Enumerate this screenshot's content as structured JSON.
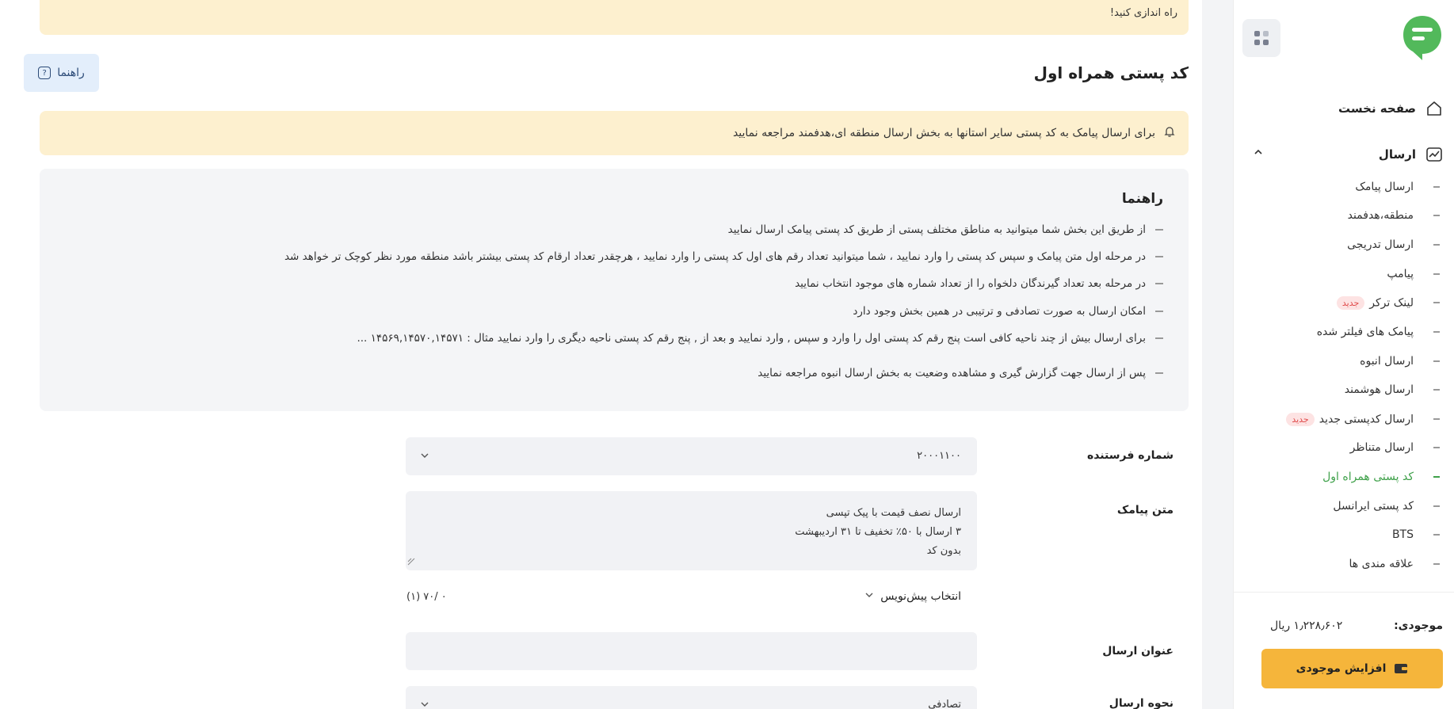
{
  "brand": {
    "accent": "#3fa14a",
    "warning_bg": "#fdf0cf",
    "topup": "#f5b53b"
  },
  "sidebar": {
    "home": "صفحه نخست",
    "send_group": "ارسال",
    "items": [
      {
        "label": "ارسال پیامک"
      },
      {
        "label": "منطقه،هدفمند"
      },
      {
        "label": "ارسال تدریجی"
      },
      {
        "label": "پیامپ"
      },
      {
        "label": "لینک ترکر",
        "badge": "جدید"
      },
      {
        "label": "پیامک های فیلتر شده"
      },
      {
        "label": "ارسال انبوه"
      },
      {
        "label": "ارسال هوشمند"
      },
      {
        "label": "ارسال کدپستی جدید",
        "badge": "جدید"
      },
      {
        "label": "ارسال متناظر"
      },
      {
        "label": "کد پستی همراه اول",
        "active": true
      },
      {
        "label": "کد پستی ایرانسل"
      },
      {
        "label": "BTS"
      },
      {
        "label": "علاقه مندی ها"
      }
    ],
    "balance_label": "موجودی:",
    "balance_value": "۱٫۲۲۸٫۶۰۲ ریال",
    "topup_label": "افزایش موجودی"
  },
  "main": {
    "top_warning": "راه اندازی کنید!",
    "title": "کد پستی همراه اول",
    "help_button": "راهنما",
    "notice": "برای ارسال پیامک به کد پستی سایر استانها به بخش ارسال منطقه ای،هدفمند مراجعه نمایید",
    "guide": {
      "title": "راهنما",
      "items": [
        "از طریق این بخش شما میتوانید به مناطق مختلف پستی از طریق کد پستی پیامک ارسال نمایید",
        "در مرحله اول متن پیامک و سپس کد پستی را وارد نمایید ، شما میتوانید تعداد رقم های اول کد پستی را وارد نمایید ، هرچقدر تعداد ارقام کد پستی بیشتر باشد منطقه مورد نظر کوچک تر خواهد شد",
        "در مرحله بعد تعداد گیرندگان دلخواه را از تعداد شماره های موجود انتخاب نمایید",
        "امکان ارسال به صورت تصادفی و ترتیبی در همین بخش وجود دارد",
        "برای ارسال بیش از چند ناحیه کافی است پنج رقم کد پستی اول را وارد و سپس , وارد نمایید و بعد از , پنج رقم کد پستی ناحیه دیگری را وارد نمایید مثال : ۱۴۵۶۹,۱۴۵۷۰,۱۴۵۷۱ ...",
        "پس از ارسال جهت گزارش گیری و مشاهده وضعیت به بخش ارسال انبوه مراجعه نمایید"
      ]
    },
    "form": {
      "sender_label": "شماره فرستنده",
      "sender_value": "۲۰۰۰۱۱۰۰",
      "message_label": "متن پیامک",
      "message_lines": [
        "ارسال نصف قیمت با پیک تپسی",
        "۳ ارسال با ۵۰٪ تخفیف تا ۳۱ اردیبهشت",
        "بدون کد"
      ],
      "draft_label": "انتخاب پیش‌نویس",
      "counter": "۰ /۷۰  (۱)",
      "subject_label": "عنوان ارسال",
      "subject_value": "",
      "mode_label": "نحوه ارسال",
      "mode_value": "تصادفی"
    }
  }
}
